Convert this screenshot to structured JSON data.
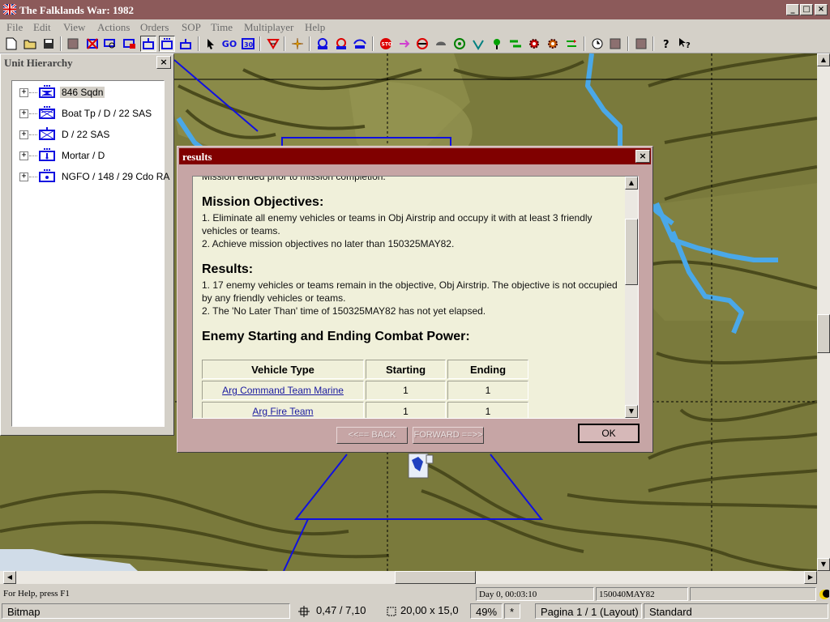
{
  "window": {
    "title": "The Falklands War: 1982",
    "controls": [
      "_",
      "□",
      "×"
    ]
  },
  "menubar": [
    "File",
    "Edit",
    "View",
    "Actions",
    "Orders",
    "SOP",
    "Time",
    "Multiplayer",
    "Help"
  ],
  "toolbar": {
    "go_label": "GO"
  },
  "unit_hierarchy": {
    "title": "Unit Hierarchy",
    "close": "×",
    "nodes": [
      {
        "label": "846 Sqdn",
        "selected": true,
        "icon": "aviation-unit-icon"
      },
      {
        "label": "Boat Tp / D / 22 SAS",
        "selected": false,
        "icon": "recon-unit-icon"
      },
      {
        "label": "D / 22 SAS",
        "selected": false,
        "icon": "infantry-unit-icon"
      },
      {
        "label": "Mortar / D",
        "selected": false,
        "icon": "mortar-unit-icon"
      },
      {
        "label": "NGFO / 148 / 29 Cdo RA",
        "selected": false,
        "icon": "artillery-unit-icon"
      }
    ],
    "expander": "+"
  },
  "results_dialog": {
    "title": "results",
    "close": "×",
    "cut_text": "Mission ended prior to mission completion.",
    "objectives_heading": "Mission Objectives:",
    "objectives": [
      "1. Eliminate all enemy vehicles or teams in Obj Airstrip and occupy it with at least 3 friendly vehicles or teams.",
      "2. Achieve mission objectives no later than 150325MAY82."
    ],
    "results_heading": "Results:",
    "results": [
      "1. 17 enemy vehicles or teams remain in the objective, Obj Airstrip. The objective is not occupied by any friendly vehicles or teams.",
      "2. The 'No Later Than' time of 150325MAY82 has not yet elapsed."
    ],
    "combat_power_heading": "Enemy Starting and Ending Combat Power:",
    "table": {
      "headers": [
        "Vehicle Type",
        "Starting",
        "Ending"
      ],
      "rows": [
        {
          "type": "Arg Command Team Marine",
          "starting": "1",
          "ending": "1"
        },
        {
          "type": "Arg Fire Team",
          "starting": "1",
          "ending": "1"
        }
      ]
    },
    "back_label": "<<== BACK",
    "forward_label": "FORWARD ==>>",
    "ok_label": "OK"
  },
  "statusbar": {
    "help": "For Help, press F1",
    "day_time": "Day 0, 00:03:10",
    "dtg": "150040MAY82"
  },
  "host_statusbar": {
    "mode": "Bitmap",
    "position": "0,47 / 7,10",
    "size": "20,00 x 15,0",
    "zoom": "49%",
    "modified": "*",
    "page": "Pagina 1 / 1 (Layout)",
    "style": "Standard"
  },
  "colors": {
    "title_bar": "#8c5a5a",
    "dialog_title": "#800000",
    "dialog_body": "#c6a5a5",
    "report_bg": "#f0f0da",
    "map_terrain": "#7a7a3c",
    "contour": "#4a4a1c",
    "river": "#4aa8e8",
    "graphics_blue": "#1010e0",
    "link_blue": "#1a1aa0"
  }
}
